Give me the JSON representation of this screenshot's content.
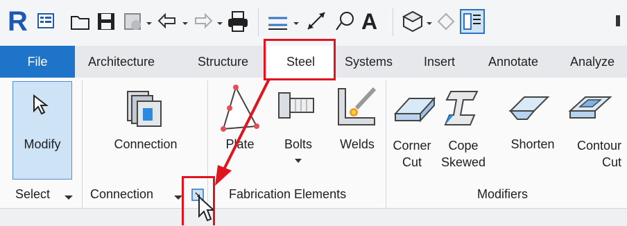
{
  "tabs": [
    "File",
    "Architecture",
    "Structure",
    "Steel",
    "Systems",
    "Insert",
    "Annotate",
    "Analyze"
  ],
  "panels": {
    "select": {
      "title": "Select",
      "buttons": [
        "Modify"
      ]
    },
    "connection": {
      "title": "Connection",
      "buttons": [
        "Connection"
      ]
    },
    "fabrication": {
      "title": "Fabrication Elements",
      "buttons": [
        "Plate",
        "Bolts",
        "Welds"
      ]
    },
    "modifiers": {
      "title": "Modifiers",
      "buttons": [
        "Corner\nCut",
        "Cope\nSkewed",
        "Shorten",
        "Contour\nCut"
      ]
    }
  },
  "colors": {
    "accent_file": "#1d74c9",
    "highlight": "#e0141f"
  },
  "icons": [
    "revit-logo",
    "app-menu-icon",
    "open-icon",
    "save-icon",
    "sync-icon",
    "undo-icon",
    "redo-icon",
    "print-icon",
    "measure-icon",
    "dimension-icon",
    "tag-icon",
    "text-icon",
    "3d-view-icon",
    "section-icon",
    "tile-windows-icon"
  ]
}
